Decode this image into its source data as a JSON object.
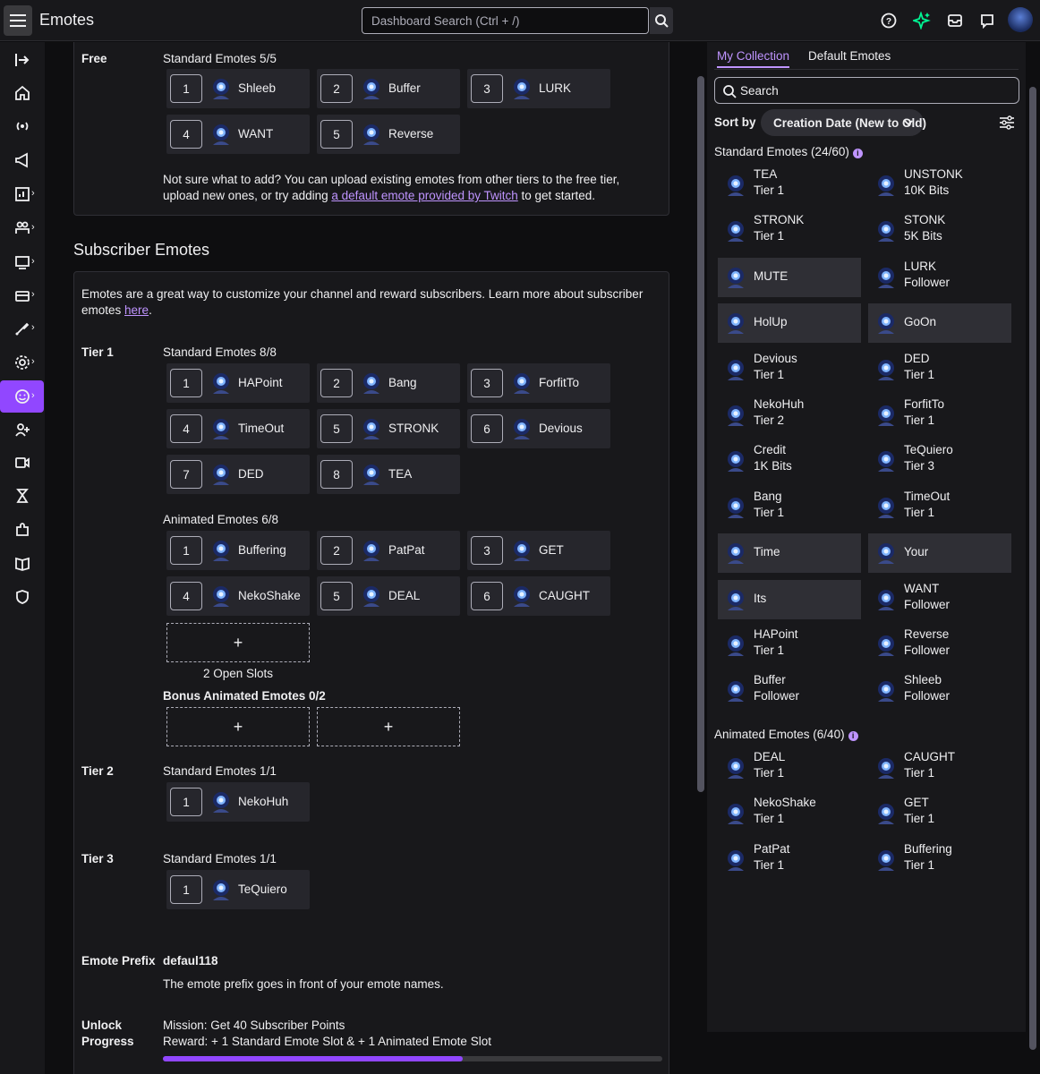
{
  "topbar": {
    "title": "Emotes",
    "search_placeholder": "Dashboard Search (Ctrl + /)",
    "icons": [
      "menu-icon",
      "search-icon",
      "help-icon",
      "sparkle-icon",
      "inbox-icon",
      "whispers-icon",
      "avatar"
    ]
  },
  "sidebar": {
    "items": [
      "collapse-icon",
      "home-icon",
      "stream-icon",
      "promote-icon",
      "analytics-icon",
      "community-icon",
      "content-icon",
      "monetization-icon",
      "creator-tools-icon",
      "settings-icon",
      "emotes-icon",
      "collaborate-icon",
      "video-icon",
      "viewer-rewards-icon",
      "extensions-icon",
      "learn-icon",
      "safety-icon"
    ]
  },
  "free": {
    "label": "Free",
    "standard_label": "Standard Emotes 5/5",
    "slots": [
      {
        "num": "1",
        "name": "Shleeb"
      },
      {
        "num": "2",
        "name": "Buffer"
      },
      {
        "num": "3",
        "name": "LURK"
      },
      {
        "num": "4",
        "name": "WANT"
      },
      {
        "num": "5",
        "name": "Reverse"
      }
    ],
    "hint_line1": "Not sure what to add? You can upload existing emotes from other tiers to the free tier,",
    "hint_line2_pre": "upload new ones, or try adding ",
    "hint_link": "a default emote provided by Twitch",
    "hint_line2_post": " to get started."
  },
  "subscriber": {
    "title": "Subscriber Emotes",
    "intro_line1": "Emotes are a great way to customize your channel and reward subscribers. Learn more about subscriber",
    "intro_line2_pre": "emotes ",
    "intro_link": "here",
    "intro_line2_post": ".",
    "tier1": {
      "label": "Tier 1",
      "standard_label": "Standard Emotes 8/8",
      "standard": [
        {
          "num": "1",
          "name": "HAPoint"
        },
        {
          "num": "2",
          "name": "Bang"
        },
        {
          "num": "3",
          "name": "ForfitTo"
        },
        {
          "num": "4",
          "name": "TimeOut"
        },
        {
          "num": "5",
          "name": "STRONK"
        },
        {
          "num": "6",
          "name": "Devious"
        },
        {
          "num": "7",
          "name": "DED"
        },
        {
          "num": "8",
          "name": "TEA"
        }
      ],
      "animated_label": "Animated Emotes 6/8",
      "animated": [
        {
          "num": "1",
          "name": "Buffering"
        },
        {
          "num": "2",
          "name": "PatPat"
        },
        {
          "num": "3",
          "name": "GET"
        },
        {
          "num": "4",
          "name": "NekoShake"
        },
        {
          "num": "5",
          "name": "DEAL"
        },
        {
          "num": "6",
          "name": "CAUGHT"
        }
      ],
      "open_slot_symbol": "+",
      "open_slots_text": "2 Open Slots",
      "bonus_label": "Bonus Animated Emotes 0/2"
    },
    "tier2": {
      "label": "Tier 2",
      "standard_label": "Standard Emotes 1/1",
      "standard": [
        {
          "num": "1",
          "name": "NekoHuh"
        }
      ]
    },
    "tier3": {
      "label": "Tier 3",
      "standard_label": "Standard Emotes 1/1",
      "standard": [
        {
          "num": "1",
          "name": "TeQuiero"
        }
      ]
    },
    "prefix_label": "Emote Prefix",
    "prefix_value": "defaul118",
    "prefix_hint": "The emote prefix goes in front of your emote names.",
    "unlock_label_1": "Unlock",
    "unlock_label_2": "Progress",
    "mission": "Mission: Get 40 Subscriber Points",
    "reward": "Reward: + 1 Standard Emote Slot & + 1 Animated Emote Slot",
    "progress_fraction": 0.6
  },
  "collection": {
    "tabs": [
      "My Collection",
      "Default Emotes"
    ],
    "search_placeholder": "Search",
    "sort_label": "Sort by",
    "sort_value": "Creation Date (New to Old)",
    "standard_header": "Standard Emotes (24/60)",
    "standard": [
      {
        "name": "TEA",
        "sub": "Tier 1"
      },
      {
        "name": "UNSTONK",
        "sub": "10K Bits"
      },
      {
        "name": "STRONK",
        "sub": "Tier 1"
      },
      {
        "name": "STONK",
        "sub": "5K Bits"
      },
      {
        "name": "MUTE",
        "sub": ""
      },
      {
        "name": "LURK",
        "sub": "Follower"
      },
      {
        "name": "HolUp",
        "sub": ""
      },
      {
        "name": "GoOn",
        "sub": ""
      },
      {
        "name": "Devious",
        "sub": "Tier 1"
      },
      {
        "name": "DED",
        "sub": "Tier 1"
      },
      {
        "name": "NekoHuh",
        "sub": "Tier 2"
      },
      {
        "name": "ForfitTo",
        "sub": "Tier 1"
      },
      {
        "name": "Credit",
        "sub": "1K Bits"
      },
      {
        "name": "TeQuiero",
        "sub": "Tier 3"
      },
      {
        "name": "Bang",
        "sub": "Tier 1"
      },
      {
        "name": "TimeOut",
        "sub": "Tier 1"
      },
      {
        "name": "Time",
        "sub": ""
      },
      {
        "name": "Your",
        "sub": ""
      },
      {
        "name": "Its",
        "sub": ""
      },
      {
        "name": "WANT",
        "sub": "Follower"
      },
      {
        "name": "HAPoint",
        "sub": "Tier 1"
      },
      {
        "name": "Reverse",
        "sub": "Follower"
      },
      {
        "name": "Buffer",
        "sub": "Follower"
      },
      {
        "name": "Shleeb",
        "sub": "Follower"
      }
    ],
    "animated_header": "Animated Emotes (6/40)",
    "animated": [
      {
        "name": "DEAL",
        "sub": "Tier 1"
      },
      {
        "name": "CAUGHT",
        "sub": "Tier 1"
      },
      {
        "name": "NekoShake",
        "sub": "Tier 1"
      },
      {
        "name": "GET",
        "sub": "Tier 1"
      },
      {
        "name": "PatPat",
        "sub": "Tier 1"
      },
      {
        "name": "Buffering",
        "sub": "Tier 1"
      }
    ]
  },
  "colors": {
    "accent": "#9147ff",
    "link": "#bf94ff",
    "background": "#0e0e10",
    "panel": "#18181b"
  }
}
